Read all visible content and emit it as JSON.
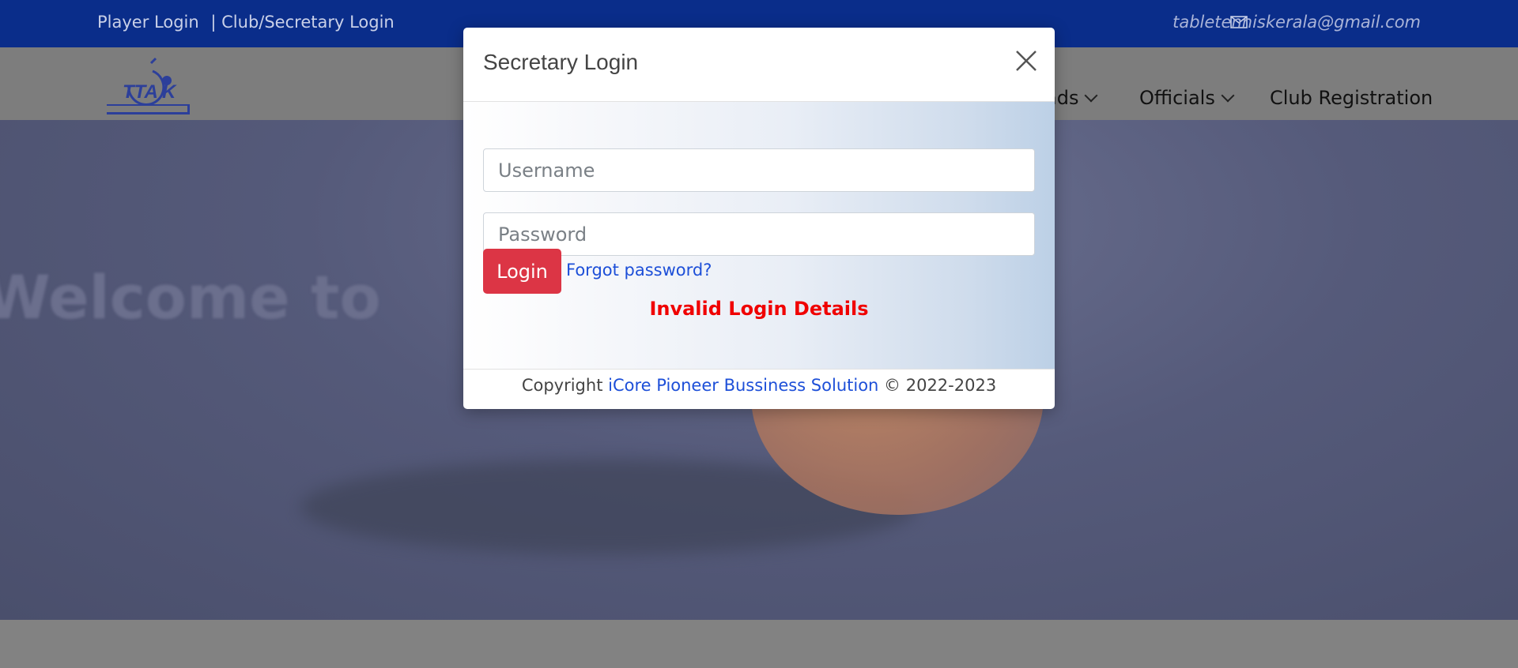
{
  "topbar": {
    "player_login": "Player Login",
    "separator": "|",
    "club_login": "Club/Secretary Login",
    "email": "tabletenniskerala@gmail.com"
  },
  "nav": {
    "items": [
      {
        "label": "ads"
      },
      {
        "label": "Officials"
      },
      {
        "label": "Club Registration"
      }
    ]
  },
  "hero": {
    "welcome_text": "Welcome to"
  },
  "modal": {
    "title": "Secretary Login",
    "username_placeholder": "Username",
    "password_placeholder": "Password",
    "login_label": "Login",
    "forgot_label": "Forgot password?",
    "error_text": "Invalid Login Details",
    "footer": {
      "copyright": "Copyright",
      "company": "iCore Pioneer Bussiness Solution",
      "years": "© 2022-2023"
    }
  },
  "colors": {
    "topbar_bg": "#0a2d8a",
    "login_button": "#dc3545",
    "error_text": "#f00000",
    "link": "#1d4fd8"
  },
  "icons": {
    "mail": "mail-icon",
    "close": "close-icon",
    "logo": "ttak-logo"
  }
}
